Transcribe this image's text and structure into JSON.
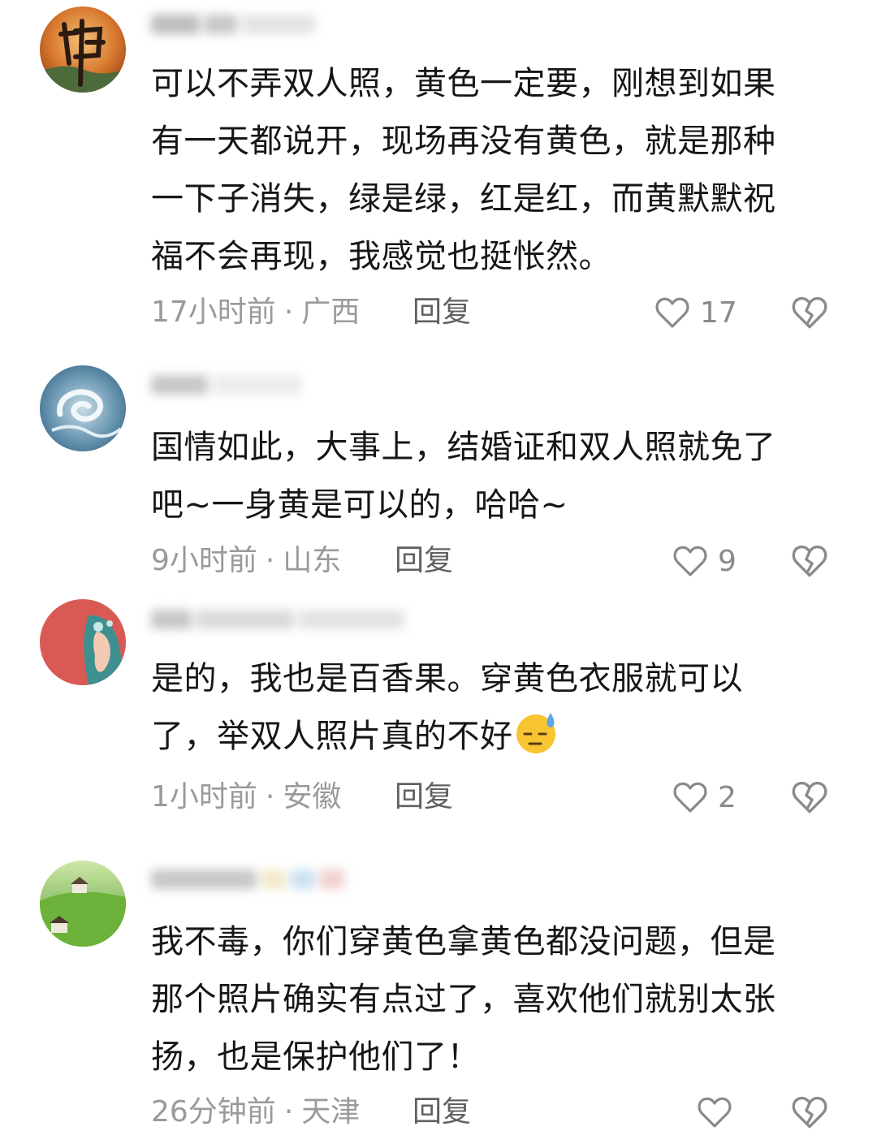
{
  "comments": [
    {
      "text_lines": [
        "可以不弄双人照，黄色一定要，刚想到如果",
        "有一天都说开，现场再没有黄色，就是那种",
        "一下子消失，绿是绿，红是红，而黄默默祝",
        "福不会再现，我感觉也挺怅然。"
      ],
      "time": "17小时前",
      "location": "广西",
      "reply_label": "回复",
      "likes": "17"
    },
    {
      "text_lines": [
        "国情如此，大事上，结婚证和双人照就免了",
        "吧~一身黄是可以的，哈哈~"
      ],
      "time": "9小时前",
      "location": "山东",
      "reply_label": "回复",
      "likes": "9"
    },
    {
      "text_lines": [
        "是的，我也是百香果。穿黄色衣服就可以",
        "了，举双人照片真的不好"
      ],
      "emoji": "sweat-smile-emoji",
      "time": "1小时前",
      "location": "安徽",
      "reply_label": "回复",
      "likes": "2"
    },
    {
      "text_lines": [
        "我不毒，你们穿黄色拿黄色都没问题，但是",
        "那个照片确实有点过了，喜欢他们就别太张",
        "扬，也是保护他们了！"
      ],
      "time": "26分钟前",
      "location": "天津",
      "reply_label": "回复",
      "likes": ""
    }
  ],
  "separator": "·",
  "icons": {
    "like": "heart-outline-icon",
    "dislike": "broken-heart-icon"
  },
  "colors": {
    "text": "#161616",
    "meta": "#9a9a9a",
    "icon": "#8a8a8a"
  }
}
